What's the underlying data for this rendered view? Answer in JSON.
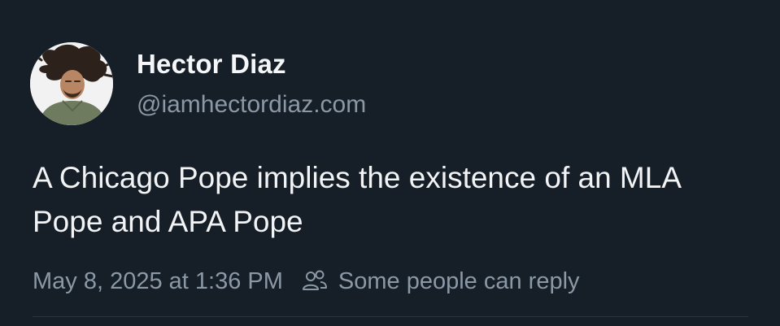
{
  "post": {
    "author": {
      "display_name": "Hector Diaz",
      "handle": "@iamhectordiaz.com"
    },
    "text": "A Chicago Pope implies the existence of an MLA Pope and APA Pope",
    "timestamp": "May 8, 2025 at 1:36 PM",
    "reply_setting": {
      "icon": "people-icon",
      "label": "Some people can reply"
    }
  },
  "colors": {
    "background": "#161e27",
    "primary_text": "#f1f3f5",
    "secondary_text": "#8b98a6"
  }
}
